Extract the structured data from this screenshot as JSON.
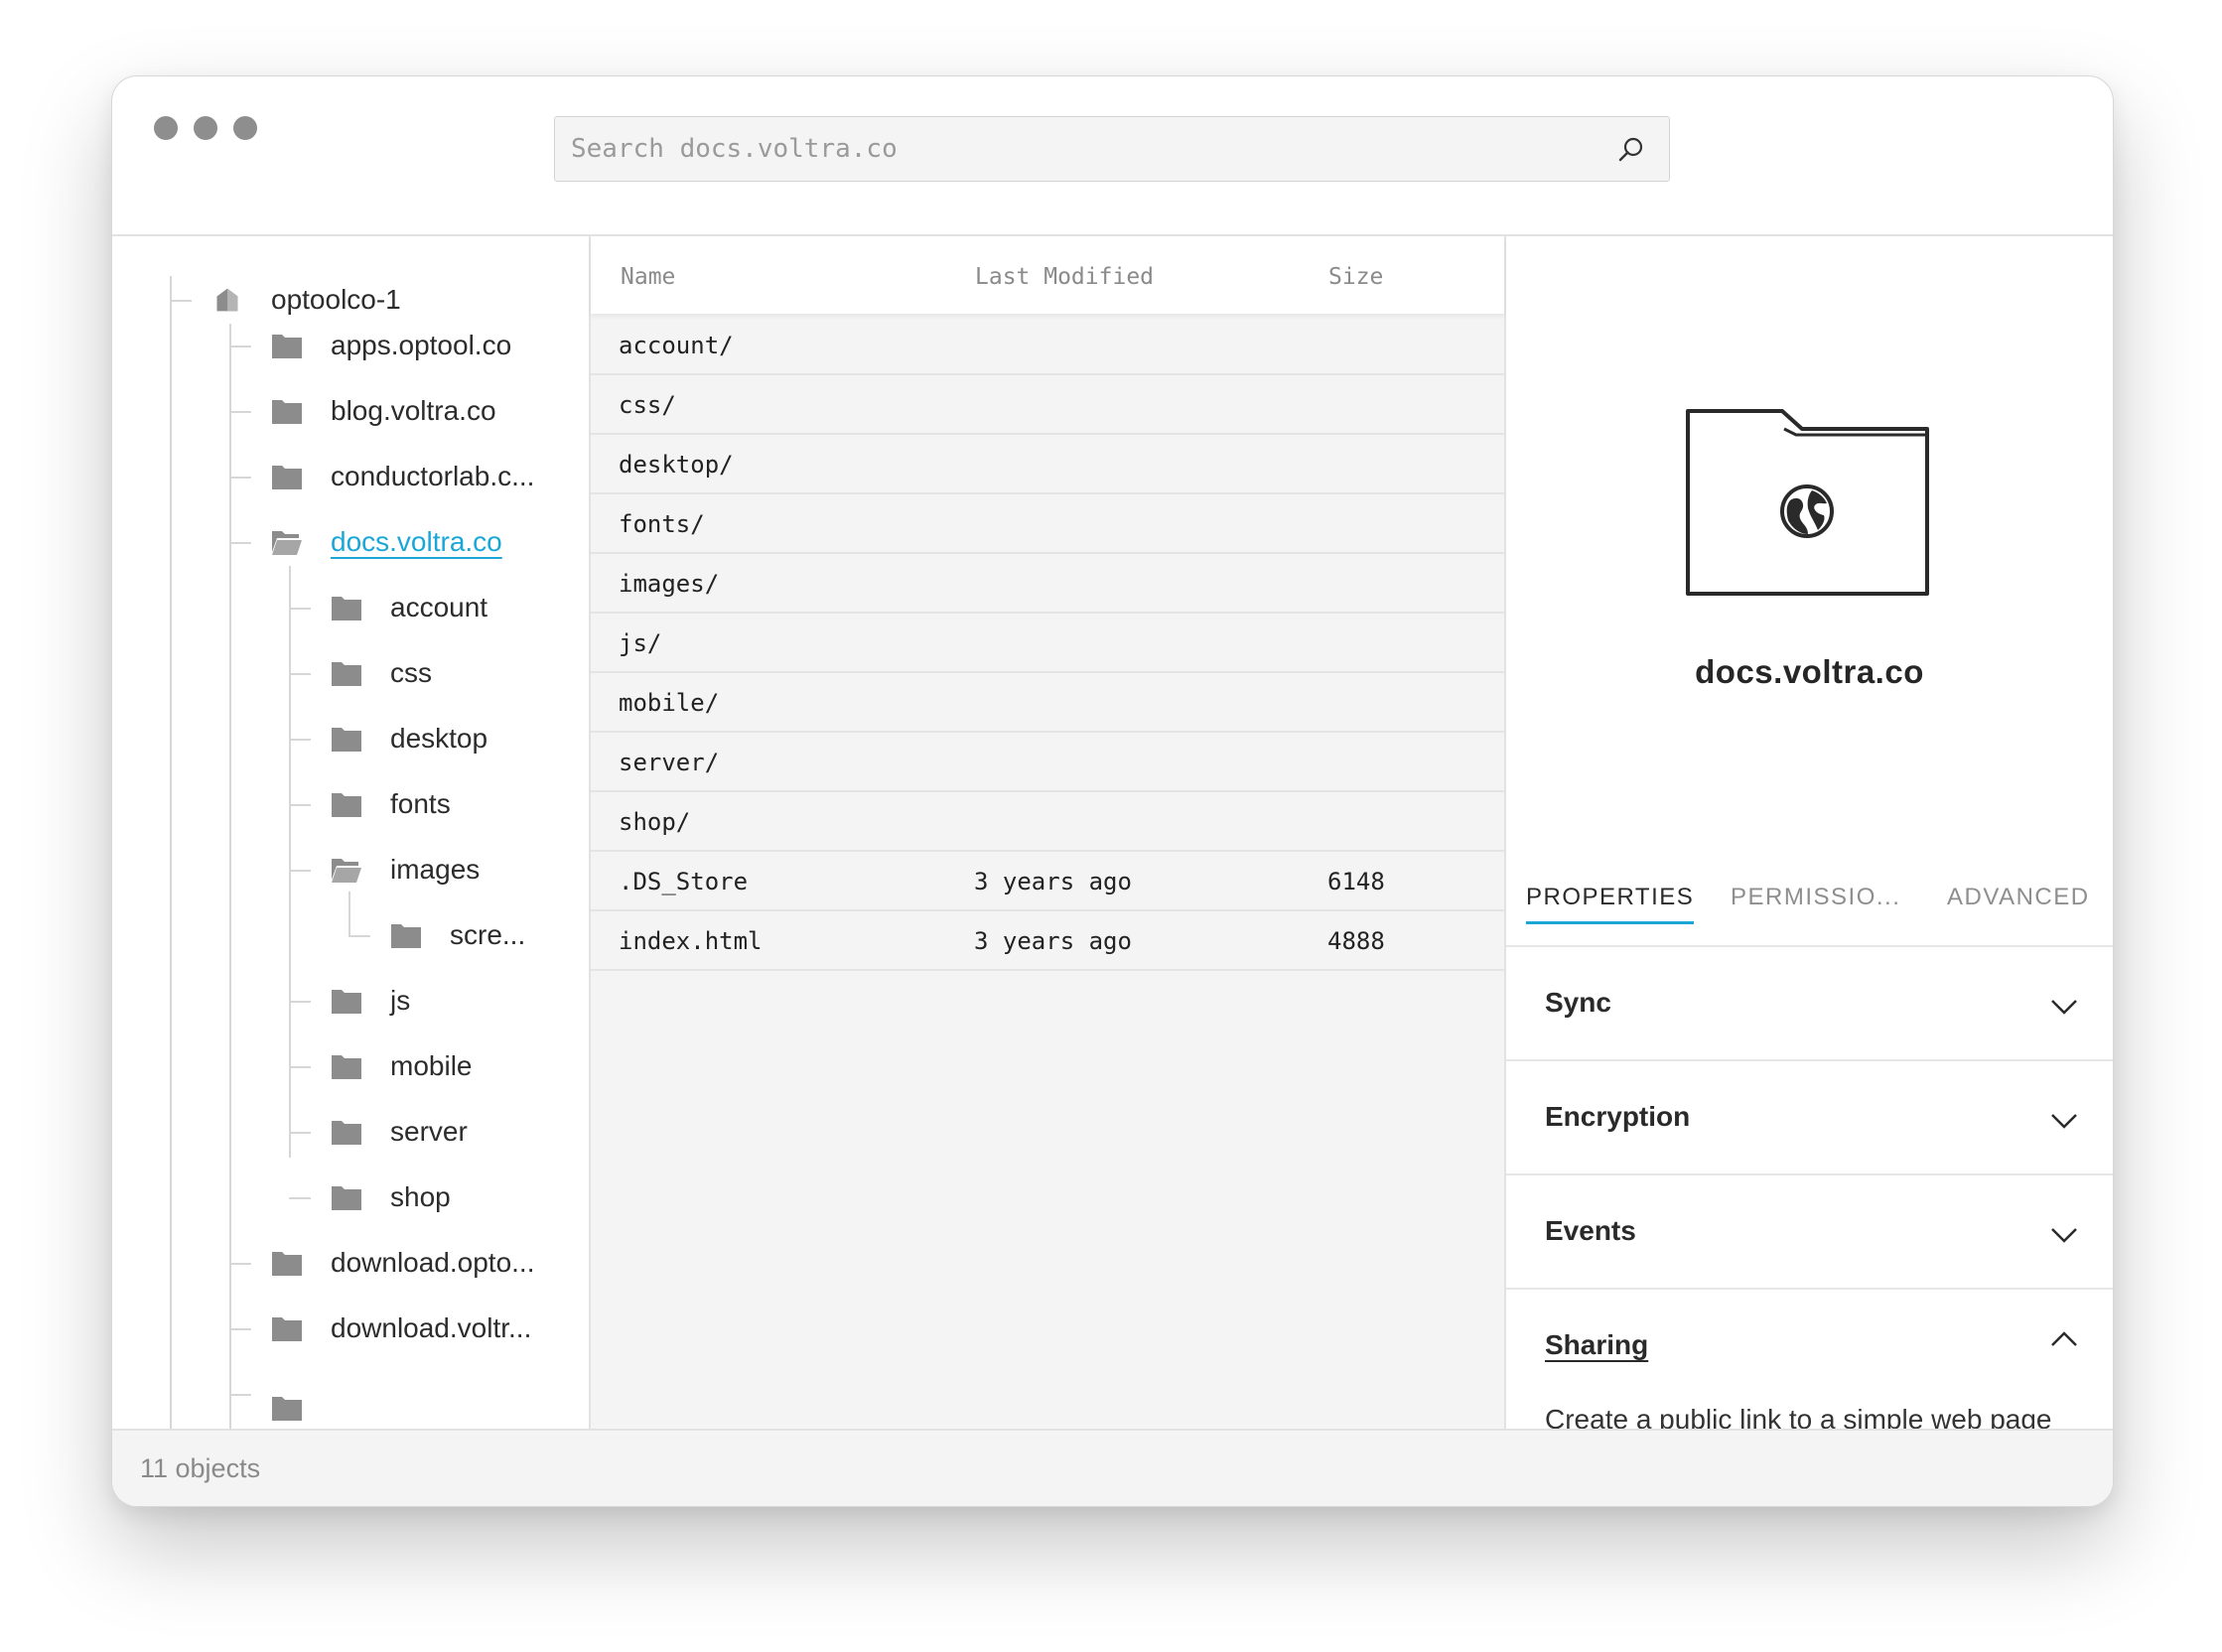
{
  "search": {
    "placeholder": "Search docs.voltra.co"
  },
  "tree": {
    "root": "optoolco-1",
    "items": [
      {
        "label": "apps.optool.co"
      },
      {
        "label": "blog.voltra.co"
      },
      {
        "label": "conductorlab.c..."
      },
      {
        "label": "docs.voltra.co",
        "selected": true
      },
      {
        "label": "account"
      },
      {
        "label": "css"
      },
      {
        "label": "desktop"
      },
      {
        "label": "fonts"
      },
      {
        "label": "images"
      },
      {
        "label": "scre..."
      },
      {
        "label": "js"
      },
      {
        "label": "mobile"
      },
      {
        "label": "server"
      },
      {
        "label": "shop"
      },
      {
        "label": "download.opto..."
      },
      {
        "label": "download.voltr..."
      }
    ]
  },
  "list": {
    "headers": {
      "name": "Name",
      "modified": "Last Modified",
      "size": "Size"
    },
    "rows": [
      {
        "name": "account/",
        "modified": "",
        "size": ""
      },
      {
        "name": "css/",
        "modified": "",
        "size": ""
      },
      {
        "name": "desktop/",
        "modified": "",
        "size": ""
      },
      {
        "name": "fonts/",
        "modified": "",
        "size": ""
      },
      {
        "name": "images/",
        "modified": "",
        "size": ""
      },
      {
        "name": "js/",
        "modified": "",
        "size": ""
      },
      {
        "name": "mobile/",
        "modified": "",
        "size": ""
      },
      {
        "name": "server/",
        "modified": "",
        "size": ""
      },
      {
        "name": "shop/",
        "modified": "",
        "size": ""
      },
      {
        "name": ".DS_Store",
        "modified": "3 years ago",
        "size": "6148"
      },
      {
        "name": "index.html",
        "modified": "3 years ago",
        "size": "4888"
      }
    ]
  },
  "details": {
    "title": "docs.voltra.co",
    "tabs": [
      "PROPERTIES",
      "PERMISSIO...",
      "ADVANCED"
    ],
    "sections": [
      "Sync",
      "Encryption",
      "Events",
      "Sharing"
    ],
    "sharing_desc": "Create a public link to a simple web page"
  },
  "status": {
    "count": "11 objects"
  },
  "colors": {
    "accent": "#1ba7d6",
    "folder": "#8c8c8c"
  }
}
